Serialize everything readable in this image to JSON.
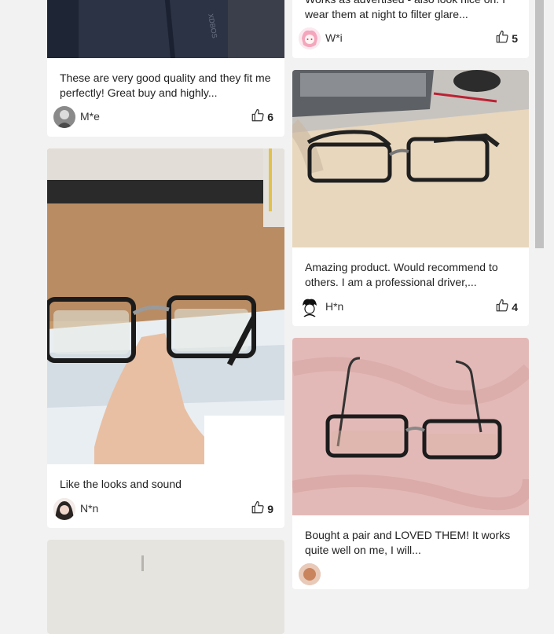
{
  "reviews": [
    {
      "text": "These are very good quality and they fit me perfectly! Great buy and highly...",
      "user": "M*e",
      "likes": "6"
    },
    {
      "text": "Like the looks and sound",
      "user": "N*n",
      "likes": "9"
    },
    {
      "text": "Works as advertised - also look nice on. I wear them at night to filter glare...",
      "user": "W*i",
      "likes": "5"
    },
    {
      "text": "Amazing product. Would recommend to others. I am a professional driver,...",
      "user": "H*n",
      "likes": "4"
    },
    {
      "text": "Bought a pair and LOVED THEM! It works quite well on me, I will...",
      "user": "",
      "likes": ""
    }
  ],
  "icons": {
    "like": "thumbs-up-icon"
  },
  "colors": {
    "page_bg": "#f2f2f2",
    "card_bg": "#ffffff",
    "text": "#222222",
    "scrollbar_thumb": "#c1c1c1"
  }
}
